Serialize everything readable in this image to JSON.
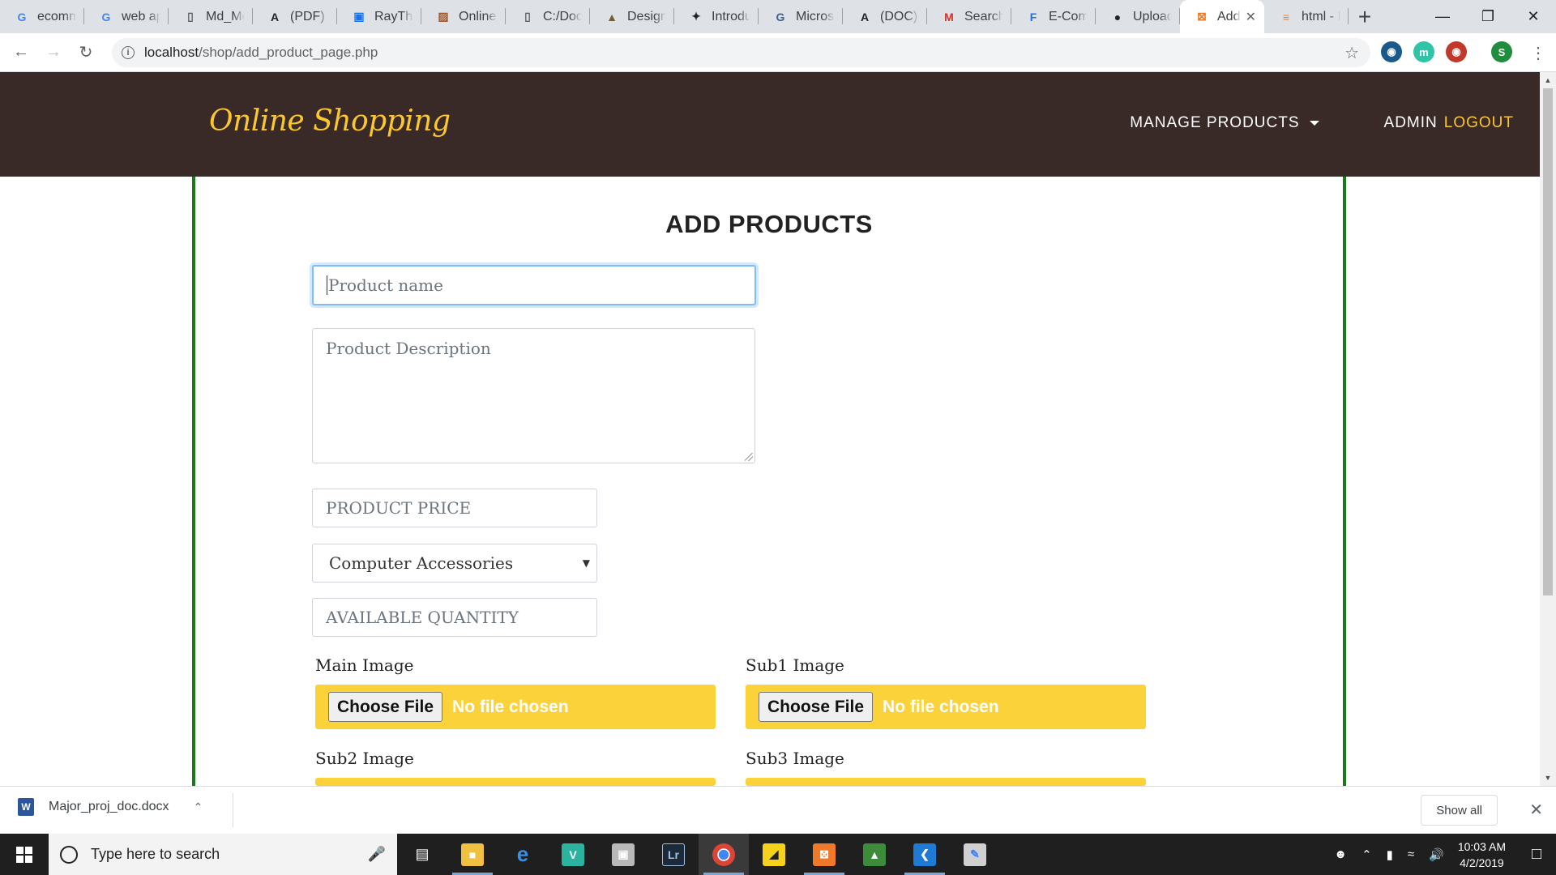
{
  "browser": {
    "tabs": [
      {
        "title": "ecomm",
        "favicon": "google-icon",
        "fav_color": "#4285f4",
        "fav_text": "G"
      },
      {
        "title": "web ap",
        "favicon": "google-icon",
        "fav_color": "#4285f4",
        "fav_text": "G"
      },
      {
        "title": "Md_Me",
        "favicon": "document-icon",
        "fav_color": "#5f6368",
        "fav_text": "▯"
      },
      {
        "title": "(PDF) Th",
        "favicon": "academia-icon",
        "fav_color": "#222222",
        "fav_text": "A"
      },
      {
        "title": "RayThe",
        "favicon": "raytheon-icon",
        "fav_color": "#1a73e8",
        "fav_text": "▣"
      },
      {
        "title": "Online S",
        "favicon": "image-icon",
        "fav_color": "#a05a2c",
        "fav_text": "▨"
      },
      {
        "title": "C:/Docu",
        "favicon": "document-icon",
        "fav_color": "#5f6368",
        "fav_text": "▯"
      },
      {
        "title": "Design",
        "favicon": "design-icon",
        "fav_color": "#7a5c2e",
        "fav_text": "▲"
      },
      {
        "title": "Introdu",
        "favicon": "bee-icon",
        "fav_color": "#222222",
        "fav_text": "✦"
      },
      {
        "title": "Microsc",
        "favicon": "microsoft-icon",
        "fav_color": "#3f5f95",
        "fav_text": "G"
      },
      {
        "title": "(DOC) C",
        "favicon": "academia-icon",
        "fav_color": "#222222",
        "fav_text": "A"
      },
      {
        "title": "Search",
        "favicon": "gmail-icon",
        "fav_color": "#d93025",
        "fav_text": "M"
      },
      {
        "title": "E-Comr",
        "favicon": "feedly-icon",
        "fav_color": "#1a73e8",
        "fav_text": "F"
      },
      {
        "title": "Upload",
        "favicon": "github-icon",
        "fav_color": "#222222",
        "fav_text": "●"
      },
      {
        "title": "Add",
        "favicon": "xampp-icon",
        "fav_color": "#f07a2a",
        "fav_text": "⊠",
        "active": true
      },
      {
        "title": "html - N",
        "favicon": "stackoverflow-icon",
        "fav_color": "#f48024",
        "fav_text": "≡"
      }
    ],
    "url_host": "localhost",
    "url_path": "/shop/add_product_page.php"
  },
  "navbar": {
    "brand": "Online Shopping",
    "manage_products": "MANAGE PRODUCTS",
    "admin": "ADMIN",
    "logout": "LOGOUT"
  },
  "form": {
    "title": "ADD PRODUCTS",
    "product_name_placeholder": "Product name",
    "product_description_placeholder": "Product Description",
    "product_price_placeholder": "PRODUCT PRICE",
    "category_selected": "Computer Accessories",
    "available_quantity_placeholder": "AVAILABLE QUANTITY",
    "main_image_label": "Main Image",
    "sub1_image_label": "Sub1 Image",
    "sub2_image_label": "Sub2 Image",
    "sub3_image_label": "Sub3 Image",
    "choose_file": "Choose File",
    "no_file": "No file chosen"
  },
  "downloads": {
    "file": "Major_proj_doc.docx",
    "show_all": "Show all"
  },
  "taskbar": {
    "search_placeholder": "Type here to search",
    "time": "10:03 AM",
    "date": "4/2/2019"
  },
  "colors": {
    "navbar_bg": "#3a2a27",
    "brand": "#fcc72e",
    "panel_border": "#1a7a1a",
    "file_bg": "#fcd23a"
  }
}
